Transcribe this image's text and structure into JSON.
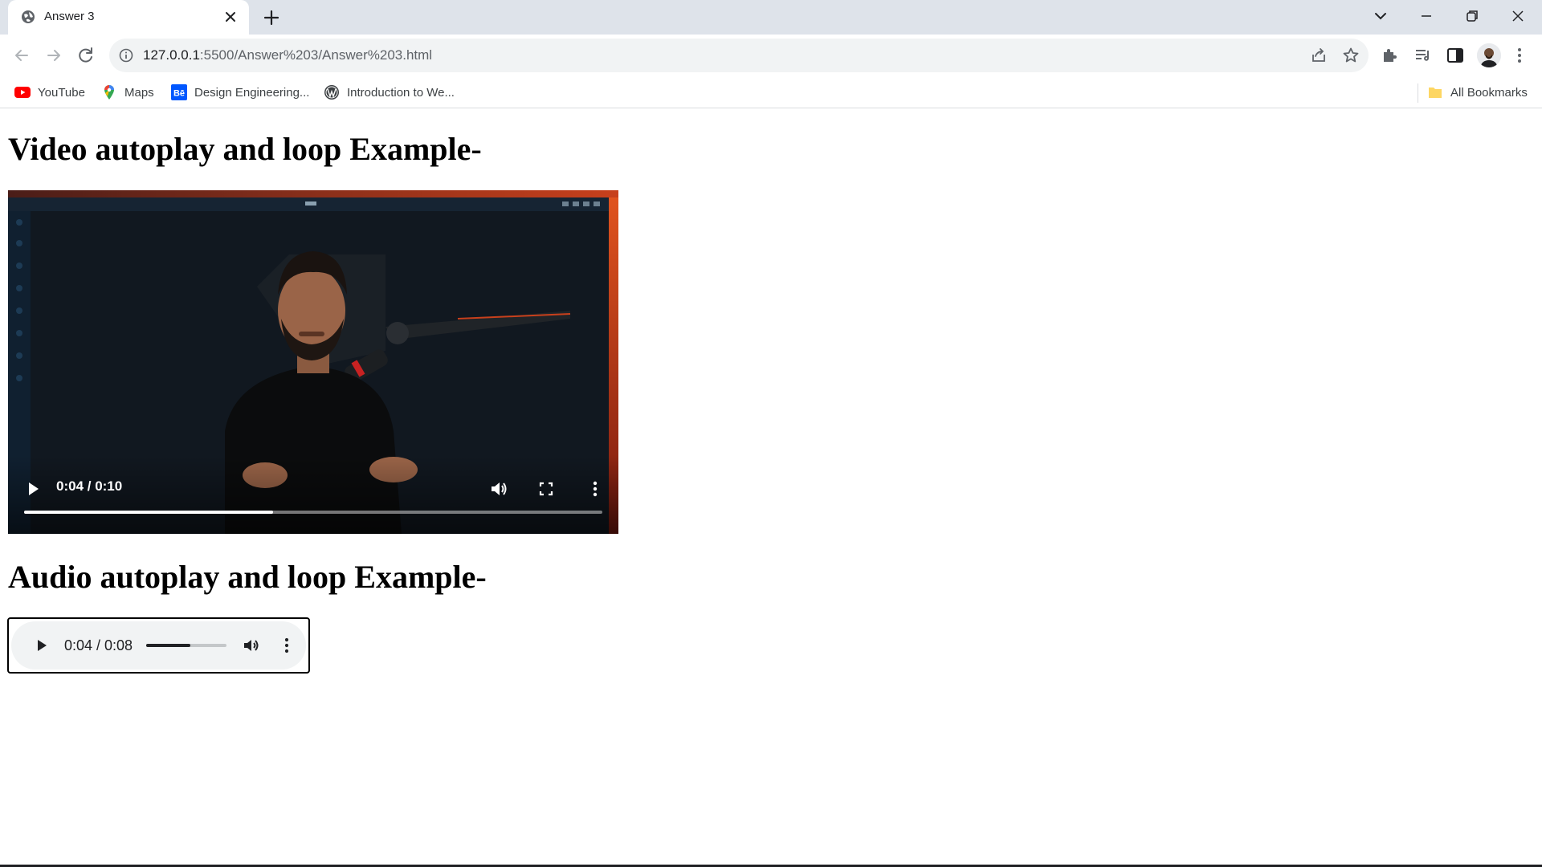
{
  "tab": {
    "title": "Answer 3"
  },
  "omnibox": {
    "host": "127.0.0.1",
    "path": ":5500/Answer%203/Answer%203.html"
  },
  "bookmarks": [
    {
      "label": "YouTube",
      "icon": "youtube-icon"
    },
    {
      "label": "Maps",
      "icon": "maps-pin-icon"
    },
    {
      "label": "Design Engineering...",
      "icon": "behance-icon"
    },
    {
      "label": "Introduction to We...",
      "icon": "wordpress-icon"
    }
  ],
  "all_bookmarks": {
    "label": "All Bookmarks"
  },
  "page": {
    "video_heading": "Video autoplay and loop Example-",
    "audio_heading": "Audio autoplay and loop Example-",
    "video": {
      "time": "0:04 / 0:10",
      "progress": 0.43
    },
    "audio": {
      "time": "0:04 / 0:08",
      "progress": 0.55
    }
  },
  "colors": {
    "tabstrip": "#dee3ea",
    "omnibox": "#f1f3f4",
    "video_bg": "#0f1419",
    "accent_orange": "#d6451b"
  }
}
